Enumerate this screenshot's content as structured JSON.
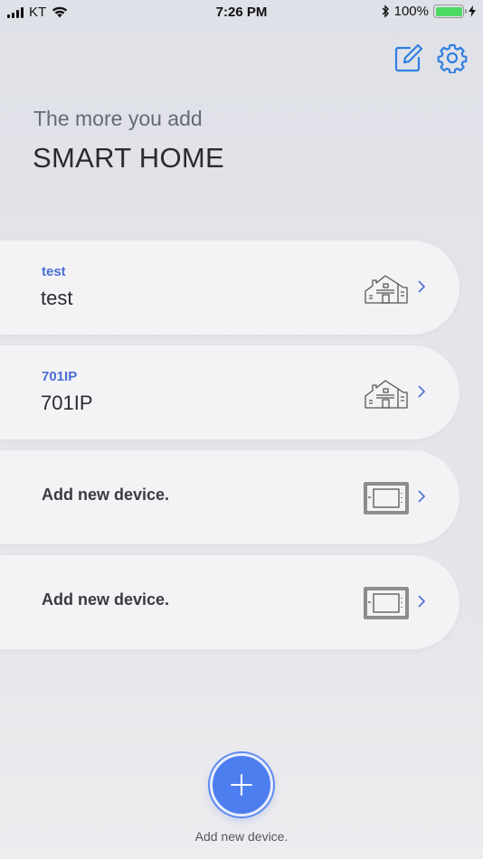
{
  "status_bar": {
    "carrier": "KT",
    "time": "7:26 PM",
    "battery": "100%"
  },
  "header": {
    "subtitle": "The more you add",
    "title": "SMART HOME",
    "edit_icon": "edit-icon",
    "settings_icon": "gear-icon"
  },
  "cards": [
    {
      "small_label": "test",
      "big_label": "test",
      "icon": "house-icon"
    },
    {
      "small_label": "701IP",
      "big_label": "701IP",
      "icon": "house-icon"
    },
    {
      "add_label": "Add new device.",
      "icon": "wallpad-device-icon"
    },
    {
      "add_label": "Add new device.",
      "icon": "wallpad-device-icon"
    }
  ],
  "fab": {
    "label": "Add new device.",
    "icon": "plus-icon"
  },
  "colors": {
    "accent": "#4d7ef0",
    "link": "#4a6fd1",
    "icon_blue": "#2f7fe0"
  }
}
